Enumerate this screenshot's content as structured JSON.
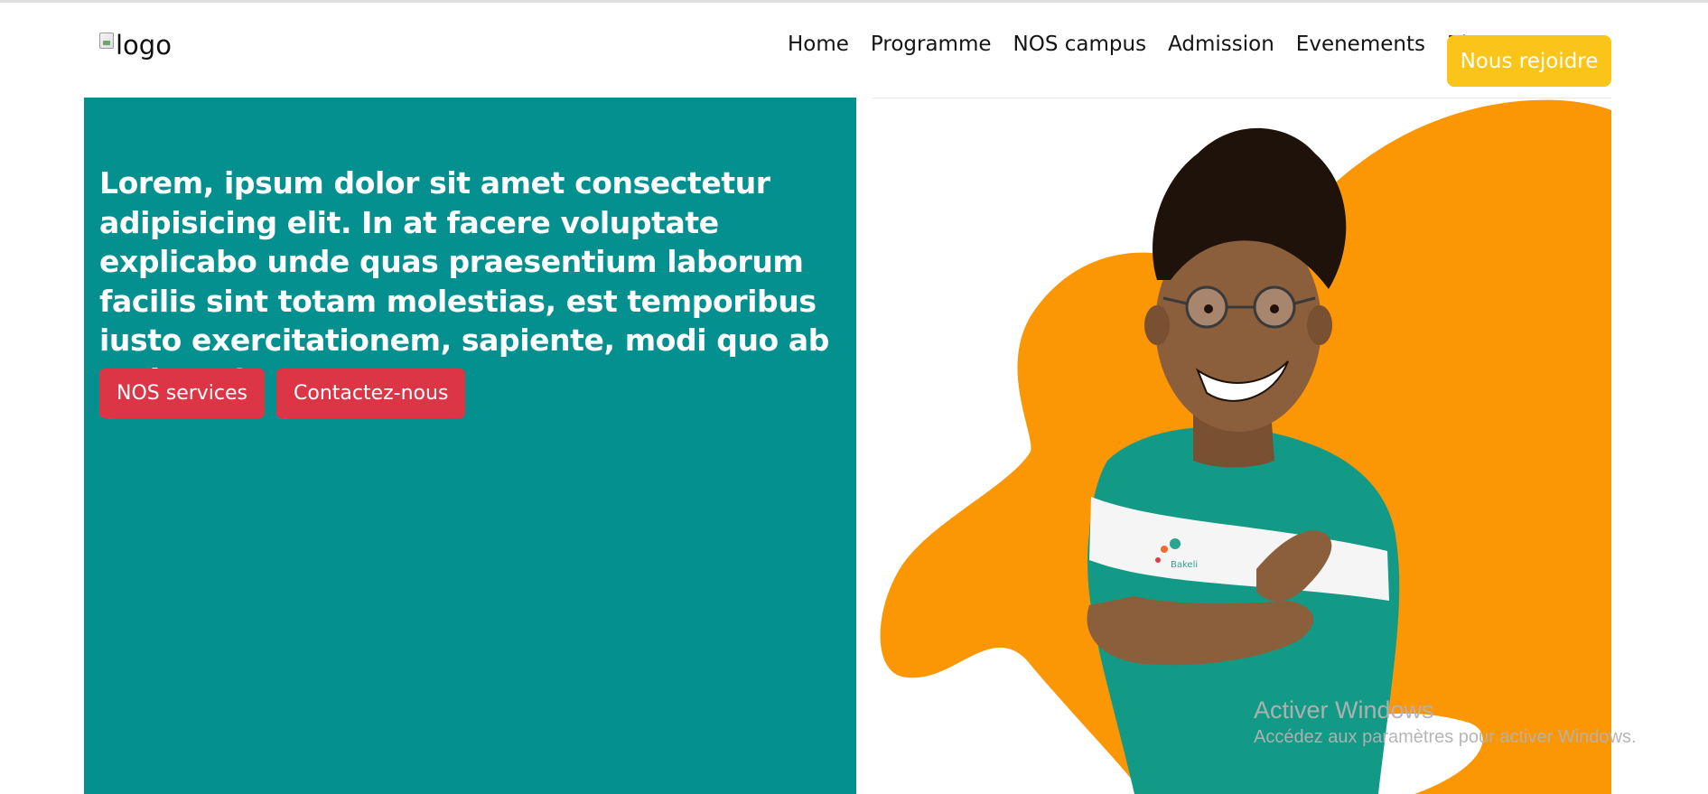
{
  "header": {
    "logo_alt": "logo",
    "nav": [
      {
        "label": "Home"
      },
      {
        "label": "Programme"
      },
      {
        "label": "NOS campus"
      },
      {
        "label": "Admission"
      },
      {
        "label": "Evenements"
      },
      {
        "label": "Blog"
      }
    ],
    "cta_label": "Nous rejoidre"
  },
  "hero": {
    "title": "Lorem, ipsum dolor sit amet consectetur adipisicing elit. In at facere voluptate explicabo unde quas praesentium laborum facilis sint totam molestias, est temporibus iusto exercitationem, sapiente, modi quo ab maiores?",
    "buttons": [
      {
        "label": "NOS services"
      },
      {
        "label": "Contactez-nous"
      }
    ],
    "illustration": "student-with-crossed-arms-illustration",
    "shirt_logo_text": "Bakeli"
  },
  "colors": {
    "teal": "#04908e",
    "orange": "#fb9604",
    "yellow": "#fbc419",
    "red": "#dc3546"
  },
  "watermark": {
    "title": "Activer Windows",
    "subtitle": "Accédez aux paramètres pour activer Windows."
  }
}
